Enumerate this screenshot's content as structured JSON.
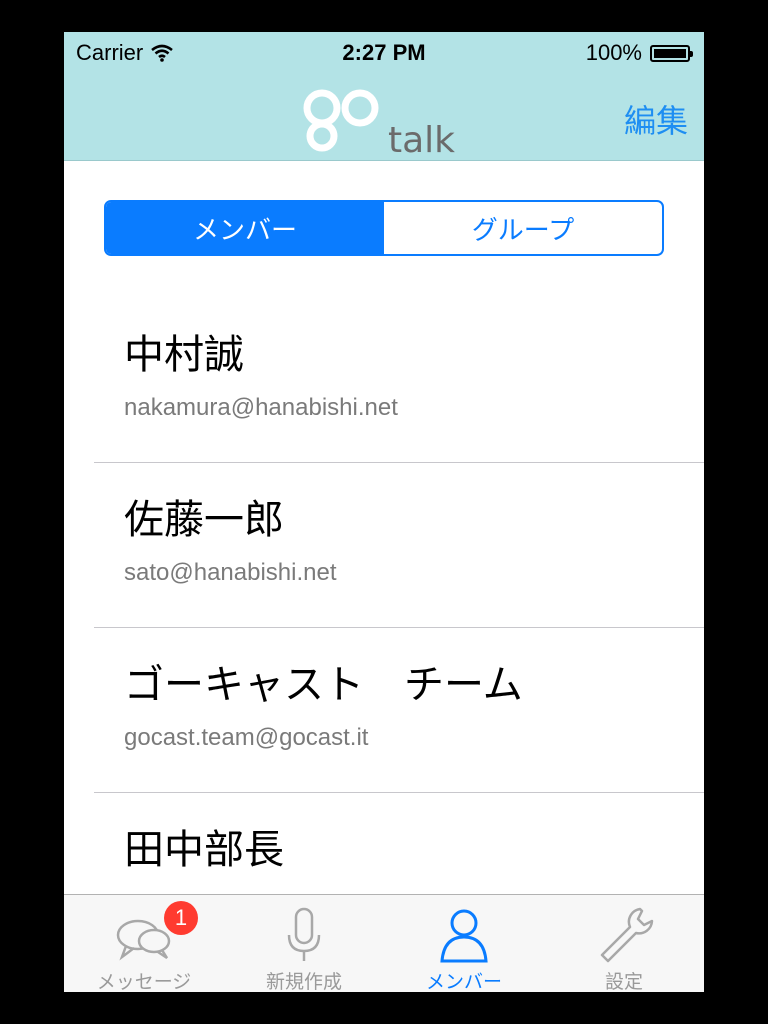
{
  "status": {
    "carrier": "Carrier",
    "time": "2:27 PM",
    "battery": "100%"
  },
  "navbar": {
    "logo_text": "go",
    "logo_sub": "talk",
    "edit_label": "編集"
  },
  "segments": [
    {
      "label": "メンバー",
      "selected": true
    },
    {
      "label": "グループ",
      "selected": false
    }
  ],
  "members": [
    {
      "name": "中村誠",
      "email": "nakamura@hanabishi.net"
    },
    {
      "name": "佐藤一郎",
      "email": "sato@hanabishi.net"
    },
    {
      "name": "ゴーキャスト　チーム",
      "email": "gocast.team@gocast.it"
    },
    {
      "name": "田中部長",
      "email": ""
    }
  ],
  "tabbar": {
    "items": [
      {
        "label": "メッセージ",
        "icon": "chat-bubbles-icon",
        "badge": "1",
        "active": false
      },
      {
        "label": "新規作成",
        "icon": "microphone-icon",
        "active": false
      },
      {
        "label": "メンバー",
        "icon": "person-icon",
        "active": true
      },
      {
        "label": "設定",
        "icon": "wrench-icon",
        "active": false
      }
    ]
  },
  "colors": {
    "header_bg": "#b3e3e6",
    "accent": "#0a7cff",
    "badge": "#ff3b30"
  }
}
